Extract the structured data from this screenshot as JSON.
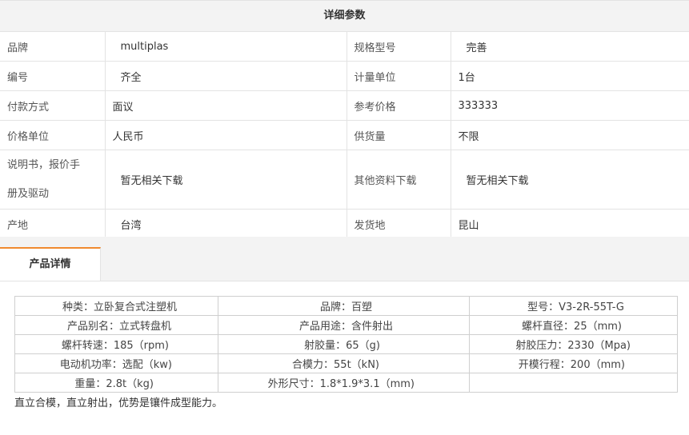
{
  "params": {
    "title": "详细参数",
    "rows": [
      {
        "k1": "品牌",
        "v1": "multiplas",
        "k2": "规格型号",
        "v2": "完善"
      },
      {
        "k1": "编号",
        "v1": "齐全",
        "k2": "计量单位",
        "v2": "1台"
      },
      {
        "k1": "付款方式",
        "v1": "面议",
        "k2": "参考价格",
        "v2": "333333"
      },
      {
        "k1": "价格单位",
        "v1": "人民币",
        "k2": "供货量",
        "v2": "不限"
      },
      {
        "k1_line1": "说明书，报价手",
        "k1_line2": "册及驱动",
        "v1": "暂无相关下载",
        "k2": "其他资料下载",
        "v2": "暂无相关下载"
      },
      {
        "k1": "产地",
        "v1": "台湾",
        "k2": "发货地",
        "v2": "昆山"
      }
    ]
  },
  "tabs": {
    "active_label": "产品详情"
  },
  "specs": [
    [
      "种类：立卧复合式注塑机",
      "品牌：百塑",
      "型号：V3-2R-55T-G"
    ],
    [
      "产品别名：立式转盘机",
      "产品用途：含件射出",
      "螺杆直径：25（mm)"
    ],
    [
      "螺杆转速：185（rpm)",
      "射胶量：65（g)",
      "射胶压力：2330（Mpa)"
    ],
    [
      "电动机功率：选配（kw)",
      "合模力：55t（kN)",
      "开模行程：200（mm)"
    ],
    [
      "重量：2.8t（kg)",
      "外形尺寸：1.8*1.9*3.1（mm)",
      ""
    ]
  ],
  "summary": "直立合模，直立射出，优势是镶件成型能力。"
}
